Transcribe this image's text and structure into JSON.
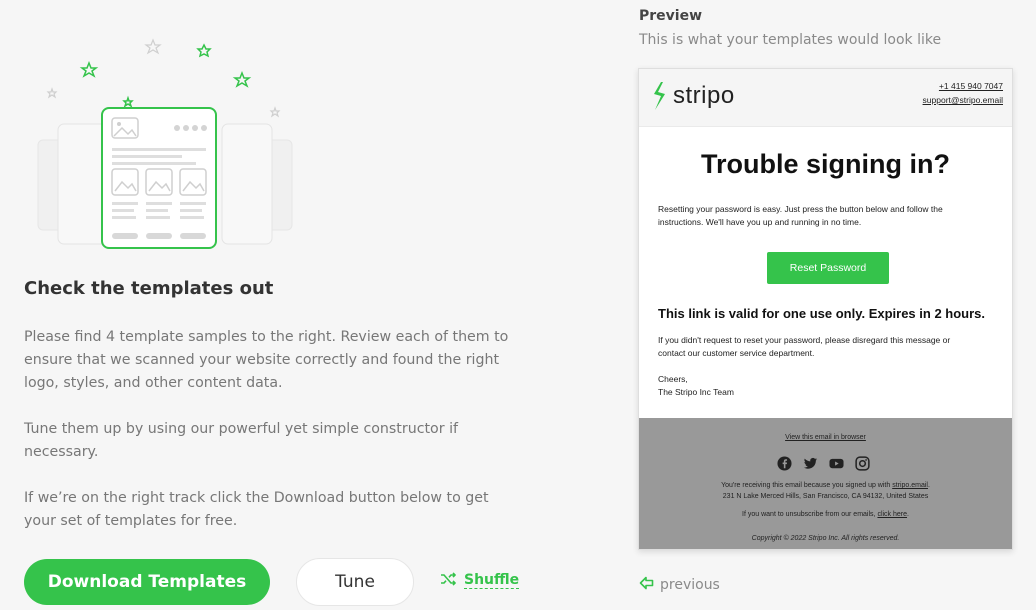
{
  "left": {
    "heading": "Check the templates out",
    "paragraphs": [
      "Please find 4 template samples to the right. Review each of them to ensure that we scanned your website correctly and found the right logo, styles, and other content data.",
      "Tune them up by using our powerful yet simple constructor if necessary.",
      "If we’re on the right track click the Download button below to get your set of templates for free."
    ],
    "download_label": "Download Templates",
    "tune_label": "Tune",
    "shuffle_label": "Shuffle"
  },
  "preview": {
    "title": "Preview",
    "subtitle": "This is what your templates would look like",
    "previous_label": "previous"
  },
  "email": {
    "logo_text": "stripo",
    "phone": "+1 415 940 7047",
    "support": "support@stripo.email",
    "title": "Trouble signing in?",
    "intro": "Resetting your password is easy. Just press the button below and follow the instructions. We'll have you up and running in no time.",
    "button": "Reset Password",
    "validity": "This link is valid for one use only. Expires in 2 hours.",
    "note": "If you didn't request to reset your password, please disregard this message or contact our customer service department.",
    "signoff": "Cheers,",
    "team": "The Stripo Inc Team",
    "footer": {
      "view_in_browser": "View this email in browser",
      "receiving_prefix": "You're receiving this email because you signed up with ",
      "receiving_link": "stripo.email",
      "receiving_suffix": ".",
      "address": "231 N Lake Merced Hills, San Francisco, CA 94132, United States",
      "unsubscribe_prefix": "If you want to unsubscribe from our emails, ",
      "unsubscribe_link": "click here",
      "unsubscribe_suffix": ".",
      "copyright": "Copyright © 2022 Stripo Inc. All rights reserved."
    },
    "social_icons": [
      "facebook-icon",
      "twitter-icon",
      "youtube-icon",
      "instagram-icon"
    ]
  },
  "colors": {
    "accent": "#35c34b",
    "footer_bg": "#999999",
    "page_bg": "#f6f6f6"
  }
}
